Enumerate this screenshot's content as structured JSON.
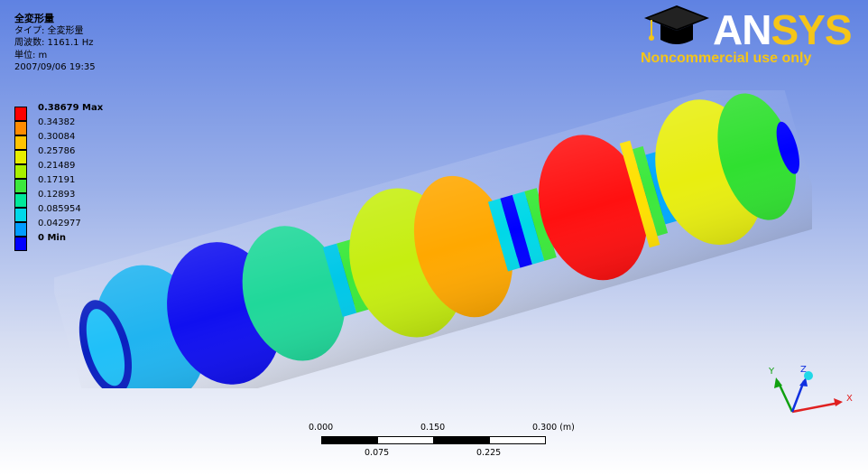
{
  "info": {
    "title": "全変形量",
    "type_line": "タイプ: 全変形量",
    "frequency_line": "周波数: 1161.1 Hz",
    "unit_line": "単位: m",
    "timestamp": "2007/09/06 19:35"
  },
  "legend": {
    "entries": [
      {
        "label": "0.38679 Max",
        "color": "#ff0000",
        "bold": true
      },
      {
        "label": "0.34382",
        "color": "#ff8c00",
        "bold": false
      },
      {
        "label": "0.30084",
        "color": "#ffc400",
        "bold": false
      },
      {
        "label": "0.25786",
        "color": "#e6ee00",
        "bold": false
      },
      {
        "label": "0.21489",
        "color": "#a8f000",
        "bold": false
      },
      {
        "label": "0.17191",
        "color": "#3ce83c",
        "bold": false
      },
      {
        "label": "0.12893",
        "color": "#00e89a",
        "bold": false
      },
      {
        "label": "0.085954",
        "color": "#00d8e8",
        "bold": false
      },
      {
        "label": "0.042977",
        "color": "#009cff",
        "bold": false
      },
      {
        "label": "0 Min",
        "color": "#0000ff",
        "bold": true
      }
    ]
  },
  "logo": {
    "brand_a": "AN",
    "brand_b": "SYS",
    "tagline": "Noncommercial use only",
    "icon": "graduation-cap-icon"
  },
  "scale_bar": {
    "top_labels": [
      "0.000",
      "0.150",
      "0.300 (m)"
    ],
    "bottom_labels": [
      "0.075",
      "0.225"
    ]
  },
  "triad": {
    "x_label": "X",
    "y_label": "Y",
    "z_label": "Z",
    "colors": {
      "x": "#e02020",
      "y": "#10a010",
      "z": "#1030e0",
      "ball": "#20d8e8"
    }
  },
  "colors": {
    "background_top": "#5f82e2",
    "background_bottom": "#ffffff",
    "max": "#ff0000",
    "min": "#0000ff"
  }
}
